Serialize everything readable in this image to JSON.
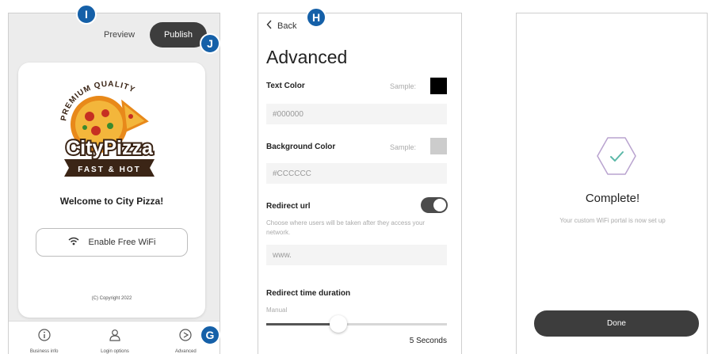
{
  "markers": {
    "i": "I",
    "j": "J",
    "h": "H",
    "g": "G"
  },
  "editor": {
    "preview_label": "Preview",
    "publish_label": "Publish",
    "welcome_text": "Welcome to City Pizza!",
    "wifi_button_label": "Enable Free WiFi",
    "copyright": "(C) Copyright 2022",
    "logo": {
      "top_text": "PREMIUM QUALITY",
      "brand_text": "CityPizza",
      "tag_text": "FAST & HOT"
    },
    "nav": [
      {
        "label": "Business info",
        "icon": "info-icon"
      },
      {
        "label": "Login options",
        "icon": "user-icon"
      },
      {
        "label": "Advanced",
        "icon": "advanced-icon"
      }
    ]
  },
  "advanced": {
    "back_label": "Back",
    "title": "Advanced",
    "sample_label": "Sample:",
    "text_color": {
      "label": "Text Color",
      "value": "#000000",
      "swatch": "#000000"
    },
    "background_color": {
      "label": "Background Color",
      "value": "#CCCCCC",
      "swatch": "#cccccc"
    },
    "redirect_url": {
      "label": "Redirect url",
      "help": "Choose where users will be taken after they access your network.",
      "placeholder": "www.",
      "enabled": true
    },
    "redirect_duration": {
      "label": "Redirect time duration",
      "mode": "Manual",
      "value_label": "5 Seconds",
      "slider_fraction": 0.4
    }
  },
  "complete": {
    "title": "Complete!",
    "subtitle": "Your custom WiFi portal is now set up",
    "done_label": "Done",
    "accent": "#5bb8a8"
  }
}
